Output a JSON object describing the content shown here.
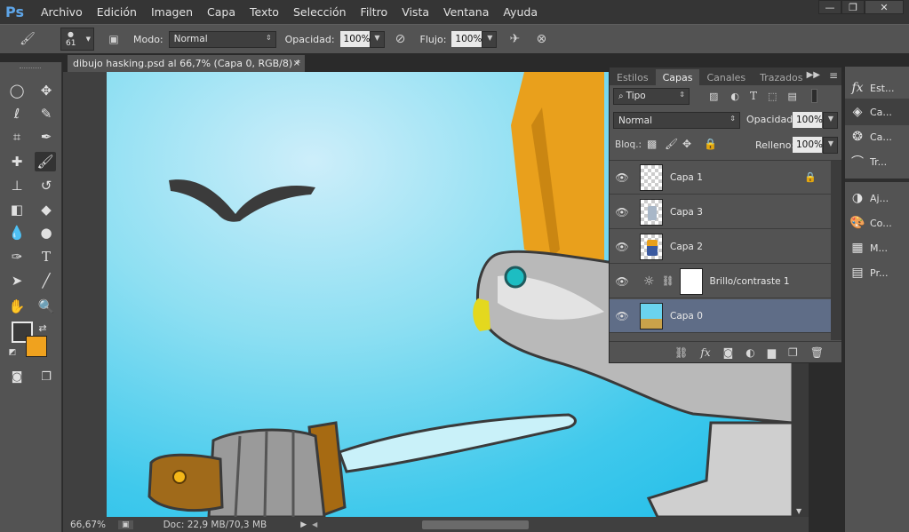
{
  "menubar": {
    "logo": "Ps",
    "items": [
      "Archivo",
      "Edición",
      "Imagen",
      "Capa",
      "Texto",
      "Selección",
      "Filtro",
      "Vista",
      "Ventana",
      "Ayuda"
    ],
    "window_buttons": [
      "—",
      "❐",
      "✕"
    ]
  },
  "options": {
    "brush_size": "61",
    "mode_label": "Modo:",
    "mode_value": "Normal",
    "opacity_label": "Opacidad:",
    "opacity_value": "100%",
    "flow_label": "Flujo:",
    "flow_value": "100%"
  },
  "document": {
    "tab_title": "dibujo hasking.psd al 66,7% (Capa 0, RGB/8) *",
    "close": "×"
  },
  "status": {
    "zoom": "66,67%",
    "doc": "Doc: 22,9 MB/70,3 MB"
  },
  "layers_panel": {
    "tabs": [
      "Estilos",
      "Capas",
      "Canales",
      "Trazados"
    ],
    "active_tab": "Capas",
    "filter_value": "Tipo",
    "blend_value": "Normal",
    "opacity_label": "Opacidad:",
    "opacity_value": "100%",
    "lock_label": "Bloq.:",
    "fill_label": "Relleno:",
    "fill_value": "100%",
    "layers": [
      {
        "name": "Capa 1",
        "locked": true
      },
      {
        "name": "Capa 3"
      },
      {
        "name": "Capa 2"
      },
      {
        "name": "Brillo/contraste 1"
      },
      {
        "name": "Capa 0",
        "selected": true
      }
    ]
  },
  "right_panel": {
    "items": [
      {
        "label": "Est...",
        "icon": "fx-icon"
      },
      {
        "label": "Ca...",
        "icon": "layers-icon"
      },
      {
        "label": "Ca...",
        "icon": "channels-icon"
      },
      {
        "label": "Tr...",
        "icon": "paths-icon"
      },
      {
        "label": "Aj...",
        "icon": "adjustments-icon"
      },
      {
        "label": "Co...",
        "icon": "color-icon"
      },
      {
        "label": "M...",
        "icon": "swatches-icon"
      },
      {
        "label": "Pr...",
        "icon": "properties-icon"
      }
    ]
  },
  "colors": {
    "foreground": "#3a3a3a",
    "background": "#f0a21e",
    "ps_blue": "#5ea5e8",
    "selection": "#5f6d87"
  }
}
